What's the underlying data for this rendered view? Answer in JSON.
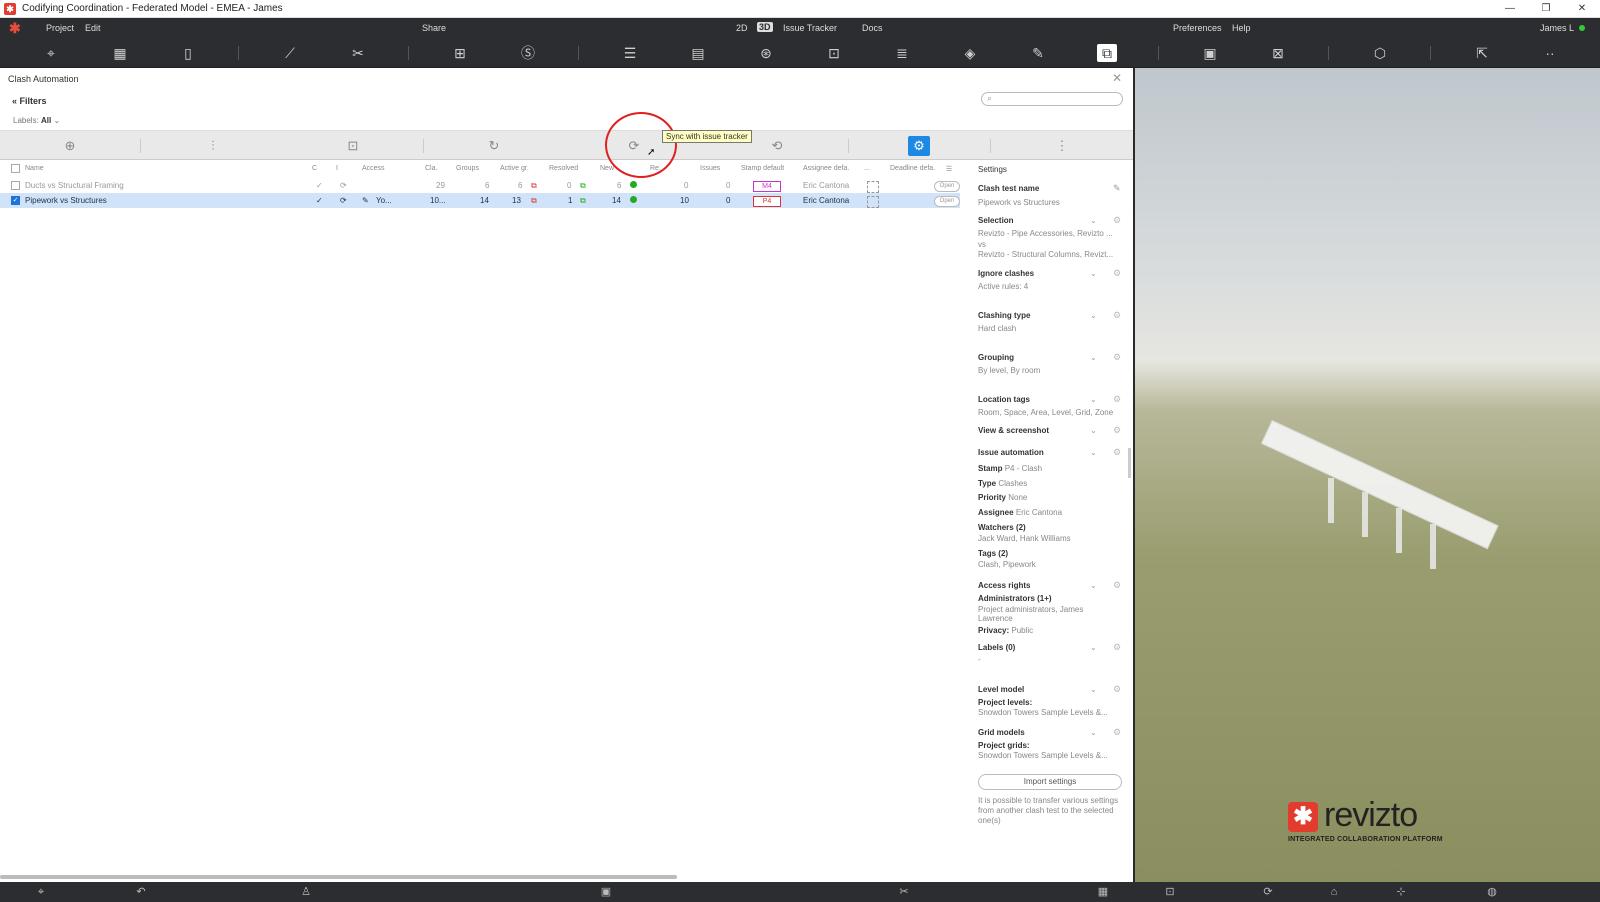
{
  "window": {
    "title": "Codifying Coordination - Federated Model - EMEA - James",
    "controls": [
      "—",
      "❐",
      "✕"
    ]
  },
  "menu": {
    "project": "Project",
    "edit": "Edit",
    "share": "Share",
    "mode_2d": "2D",
    "mode_3d": "3D",
    "issue_tracker": "Issue Tracker",
    "docs": "Docs",
    "preferences": "Preferences",
    "help": "Help",
    "user": "James L"
  },
  "panel": {
    "title": "Clash Automation",
    "filters": "Filters",
    "labels_prefix": "Labels:",
    "labels_value": "All",
    "tooltip": "Sync with issue tracker",
    "columns": [
      "Name",
      "C",
      "I",
      "Access",
      "Cla.",
      "Groups",
      "Active gr.",
      "Resolved",
      "New",
      "Re...",
      "Issues",
      "Stamp default",
      "Assignee defa.",
      "...",
      "Deadline defa."
    ],
    "rows": [
      {
        "name": "Ducts vs Structural Framing",
        "access": "",
        "clashes": "29",
        "groups": "6",
        "active": "6",
        "resolved": "0",
        "new": "6",
        "reopened": "0",
        "issues": "0",
        "stamp": "M4",
        "assignee": "Eric Cantona",
        "action": "Open"
      },
      {
        "name": "Pipework vs Structures",
        "access": "Yo...",
        "clashes": "10...",
        "groups": "14",
        "active": "13",
        "resolved": "1",
        "new": "14",
        "reopened": "10",
        "issues": "0",
        "stamp": "P4",
        "assignee": "Eric Cantona",
        "action": "Open"
      }
    ]
  },
  "settings": {
    "header": "Settings",
    "clash_test_name_label": "Clash test name",
    "clash_test_name_value": "Pipework vs Structures",
    "selection_label": "Selection",
    "selection_a": "Revizto - Pipe Accessories, Revizto ...",
    "selection_vs": "vs",
    "selection_b": "Revizto - Structural Columns, Revizt...",
    "ignore_label": "Ignore clashes",
    "ignore_value": "Active rules: 4",
    "clashing_label": "Clashing type",
    "clashing_value": "Hard clash",
    "grouping_label": "Grouping",
    "grouping_value": "By level, By room",
    "location_label": "Location tags",
    "location_value": "Room, Space, Area, Level, Grid, Zone",
    "view_label": "View & screenshot",
    "issue_auto_label": "Issue automation",
    "stamp_k": "Stamp",
    "stamp_v": "P4 - Clash",
    "type_k": "Type",
    "type_v": "Clashes",
    "priority_k": "Priority",
    "priority_v": "None",
    "assignee_k": "Assignee",
    "assignee_v": "Eric Cantona",
    "watchers_k": "Watchers (2)",
    "watchers_v": "Jack Ward, Hank Williams",
    "tags_k": "Tags (2)",
    "tags_v": "Clash, Pipework",
    "access_label": "Access rights",
    "admins_k": "Administrators (1+)",
    "admins_v": "Project administrators, James Lawrence",
    "privacy_k": "Privacy:",
    "privacy_v": "Public",
    "labels_label": "Labels (0)",
    "labels_value": "-",
    "level_label": "Level model",
    "project_levels_k": "Project levels:",
    "project_levels_v": "Snowdon Towers Sample Levels &...",
    "grid_label": "Grid models",
    "project_grids_k": "Project grids:",
    "project_grids_v": "Snowdon Towers Sample Levels &...",
    "import_button": "Import settings",
    "import_hint": "It is possible to transfer various settings from another clash test to the selected one(s)"
  },
  "brand": {
    "word": "revizto",
    "tagline": "INTEGRATED COLLABORATION PLATFORM"
  },
  "colors": {
    "accent": "#1e88e5",
    "brand": "#e23c2f",
    "highlight_row": "#d0e3f8",
    "annotation_circle": "#e02020"
  }
}
